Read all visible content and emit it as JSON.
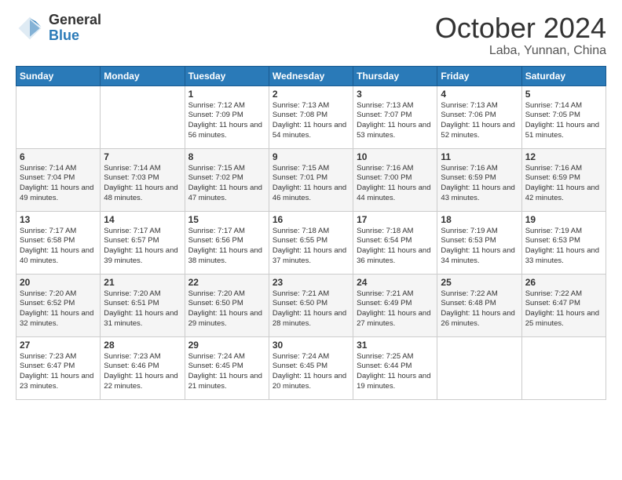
{
  "logo": {
    "general": "General",
    "blue": "Blue"
  },
  "header": {
    "month": "October 2024",
    "location": "Laba, Yunnan, China"
  },
  "weekdays": [
    "Sunday",
    "Monday",
    "Tuesday",
    "Wednesday",
    "Thursday",
    "Friday",
    "Saturday"
  ],
  "weeks": [
    [
      {
        "day": "",
        "info": ""
      },
      {
        "day": "",
        "info": ""
      },
      {
        "day": "1",
        "info": "Sunrise: 7:12 AM\nSunset: 7:09 PM\nDaylight: 11 hours and 56 minutes."
      },
      {
        "day": "2",
        "info": "Sunrise: 7:13 AM\nSunset: 7:08 PM\nDaylight: 11 hours and 54 minutes."
      },
      {
        "day": "3",
        "info": "Sunrise: 7:13 AM\nSunset: 7:07 PM\nDaylight: 11 hours and 53 minutes."
      },
      {
        "day": "4",
        "info": "Sunrise: 7:13 AM\nSunset: 7:06 PM\nDaylight: 11 hours and 52 minutes."
      },
      {
        "day": "5",
        "info": "Sunrise: 7:14 AM\nSunset: 7:05 PM\nDaylight: 11 hours and 51 minutes."
      }
    ],
    [
      {
        "day": "6",
        "info": "Sunrise: 7:14 AM\nSunset: 7:04 PM\nDaylight: 11 hours and 49 minutes."
      },
      {
        "day": "7",
        "info": "Sunrise: 7:14 AM\nSunset: 7:03 PM\nDaylight: 11 hours and 48 minutes."
      },
      {
        "day": "8",
        "info": "Sunrise: 7:15 AM\nSunset: 7:02 PM\nDaylight: 11 hours and 47 minutes."
      },
      {
        "day": "9",
        "info": "Sunrise: 7:15 AM\nSunset: 7:01 PM\nDaylight: 11 hours and 46 minutes."
      },
      {
        "day": "10",
        "info": "Sunrise: 7:16 AM\nSunset: 7:00 PM\nDaylight: 11 hours and 44 minutes."
      },
      {
        "day": "11",
        "info": "Sunrise: 7:16 AM\nSunset: 6:59 PM\nDaylight: 11 hours and 43 minutes."
      },
      {
        "day": "12",
        "info": "Sunrise: 7:16 AM\nSunset: 6:59 PM\nDaylight: 11 hours and 42 minutes."
      }
    ],
    [
      {
        "day": "13",
        "info": "Sunrise: 7:17 AM\nSunset: 6:58 PM\nDaylight: 11 hours and 40 minutes."
      },
      {
        "day": "14",
        "info": "Sunrise: 7:17 AM\nSunset: 6:57 PM\nDaylight: 11 hours and 39 minutes."
      },
      {
        "day": "15",
        "info": "Sunrise: 7:17 AM\nSunset: 6:56 PM\nDaylight: 11 hours and 38 minutes."
      },
      {
        "day": "16",
        "info": "Sunrise: 7:18 AM\nSunset: 6:55 PM\nDaylight: 11 hours and 37 minutes."
      },
      {
        "day": "17",
        "info": "Sunrise: 7:18 AM\nSunset: 6:54 PM\nDaylight: 11 hours and 36 minutes."
      },
      {
        "day": "18",
        "info": "Sunrise: 7:19 AM\nSunset: 6:53 PM\nDaylight: 11 hours and 34 minutes."
      },
      {
        "day": "19",
        "info": "Sunrise: 7:19 AM\nSunset: 6:53 PM\nDaylight: 11 hours and 33 minutes."
      }
    ],
    [
      {
        "day": "20",
        "info": "Sunrise: 7:20 AM\nSunset: 6:52 PM\nDaylight: 11 hours and 32 minutes."
      },
      {
        "day": "21",
        "info": "Sunrise: 7:20 AM\nSunset: 6:51 PM\nDaylight: 11 hours and 31 minutes."
      },
      {
        "day": "22",
        "info": "Sunrise: 7:20 AM\nSunset: 6:50 PM\nDaylight: 11 hours and 29 minutes."
      },
      {
        "day": "23",
        "info": "Sunrise: 7:21 AM\nSunset: 6:50 PM\nDaylight: 11 hours and 28 minutes."
      },
      {
        "day": "24",
        "info": "Sunrise: 7:21 AM\nSunset: 6:49 PM\nDaylight: 11 hours and 27 minutes."
      },
      {
        "day": "25",
        "info": "Sunrise: 7:22 AM\nSunset: 6:48 PM\nDaylight: 11 hours and 26 minutes."
      },
      {
        "day": "26",
        "info": "Sunrise: 7:22 AM\nSunset: 6:47 PM\nDaylight: 11 hours and 25 minutes."
      }
    ],
    [
      {
        "day": "27",
        "info": "Sunrise: 7:23 AM\nSunset: 6:47 PM\nDaylight: 11 hours and 23 minutes."
      },
      {
        "day": "28",
        "info": "Sunrise: 7:23 AM\nSunset: 6:46 PM\nDaylight: 11 hours and 22 minutes."
      },
      {
        "day": "29",
        "info": "Sunrise: 7:24 AM\nSunset: 6:45 PM\nDaylight: 11 hours and 21 minutes."
      },
      {
        "day": "30",
        "info": "Sunrise: 7:24 AM\nSunset: 6:45 PM\nDaylight: 11 hours and 20 minutes."
      },
      {
        "day": "31",
        "info": "Sunrise: 7:25 AM\nSunset: 6:44 PM\nDaylight: 11 hours and 19 minutes."
      },
      {
        "day": "",
        "info": ""
      },
      {
        "day": "",
        "info": ""
      }
    ]
  ]
}
